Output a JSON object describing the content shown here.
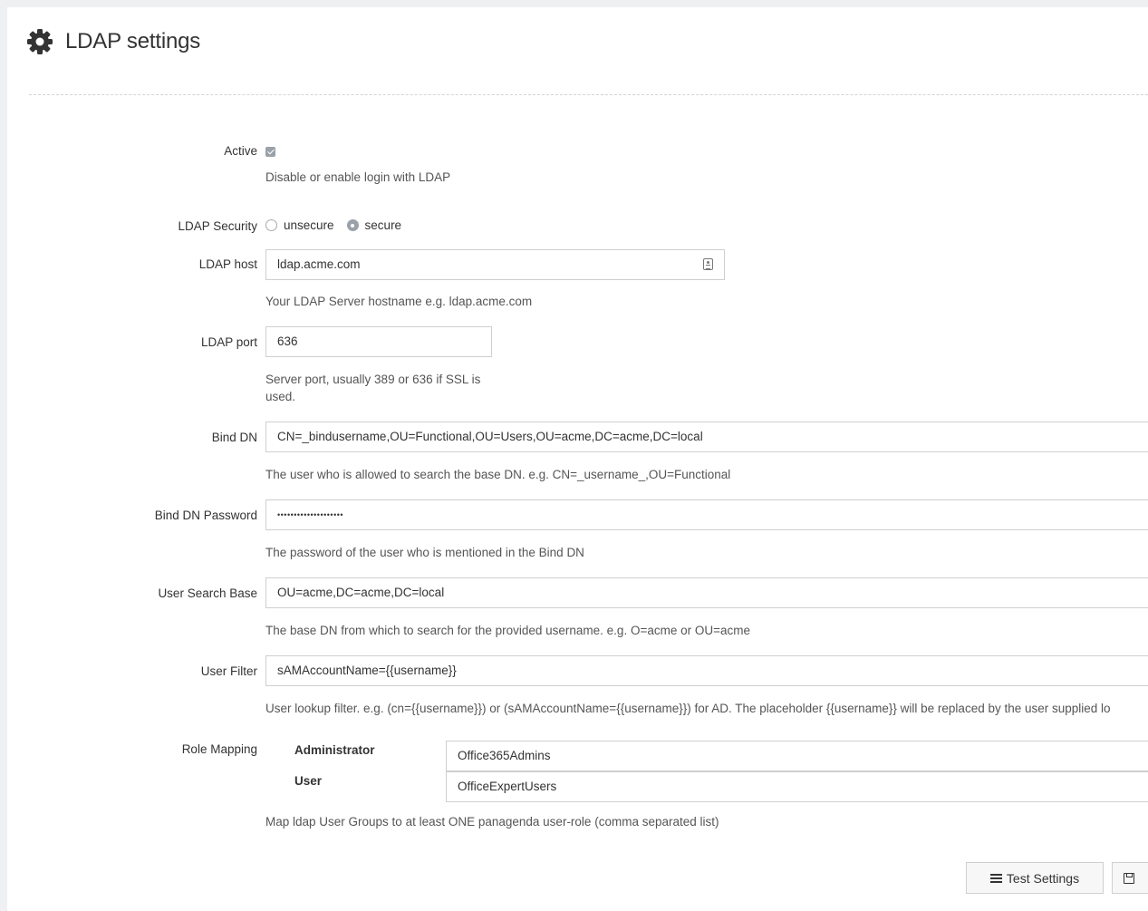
{
  "header": {
    "title": "LDAP settings",
    "icon": "gear-icon"
  },
  "form": {
    "active": {
      "label": "Active",
      "checked": true,
      "help": "Disable or enable login with LDAP"
    },
    "security": {
      "label": "LDAP Security",
      "options": [
        "unsecure",
        "secure"
      ],
      "selected": "secure"
    },
    "host": {
      "label": "LDAP host",
      "value": "ldap.acme.com",
      "help": "Your LDAP Server hostname e.g. ldap.acme.com"
    },
    "port": {
      "label": "LDAP port",
      "value": "636",
      "help_line1": "Server port, usually 389 or 636 if SSL is",
      "help_line2": "used."
    },
    "bind_dn": {
      "label": "Bind DN",
      "value": "CN=_bindusername,OU=Functional,OU=Users,OU=acme,DC=acme,DC=local",
      "help": "The user who is allowed to search the base DN. e.g. CN=_username_,OU=Functional"
    },
    "bind_password": {
      "label": "Bind DN Password",
      "value": "••••••••••••••••••••",
      "help": "The password of the user who is mentioned in the Bind DN"
    },
    "search_base": {
      "label": "User Search Base",
      "value": "OU=acme,DC=acme,DC=local",
      "help": "The base DN from which to search for the provided username. e.g. O=acme or OU=acme"
    },
    "user_filter": {
      "label": "User Filter",
      "value": "sAMAccountName={{username}}",
      "help": "User lookup filter. e.g. (cn={{username}}) or (sAMAccountName={{username}}) for AD. The placeholder {{username}} will be replaced by the user supplied lo"
    },
    "role_mapping": {
      "label": "Role Mapping",
      "roles": [
        {
          "name": "Administrator",
          "value": "Office365Admins"
        },
        {
          "name": "User",
          "value": "OfficeExpertUsers"
        }
      ],
      "help": "Map ldap User Groups to at least ONE panagenda user-role (comma separated list)"
    }
  },
  "actions": {
    "test_label": "Test Settings",
    "test_icon": "list-icon",
    "save_icon": "save-icon"
  },
  "colors": {
    "background": "#eef0f2",
    "panel": "#ffffff",
    "border": "#cfcfcf",
    "control_gray": "#9aa1a8"
  }
}
